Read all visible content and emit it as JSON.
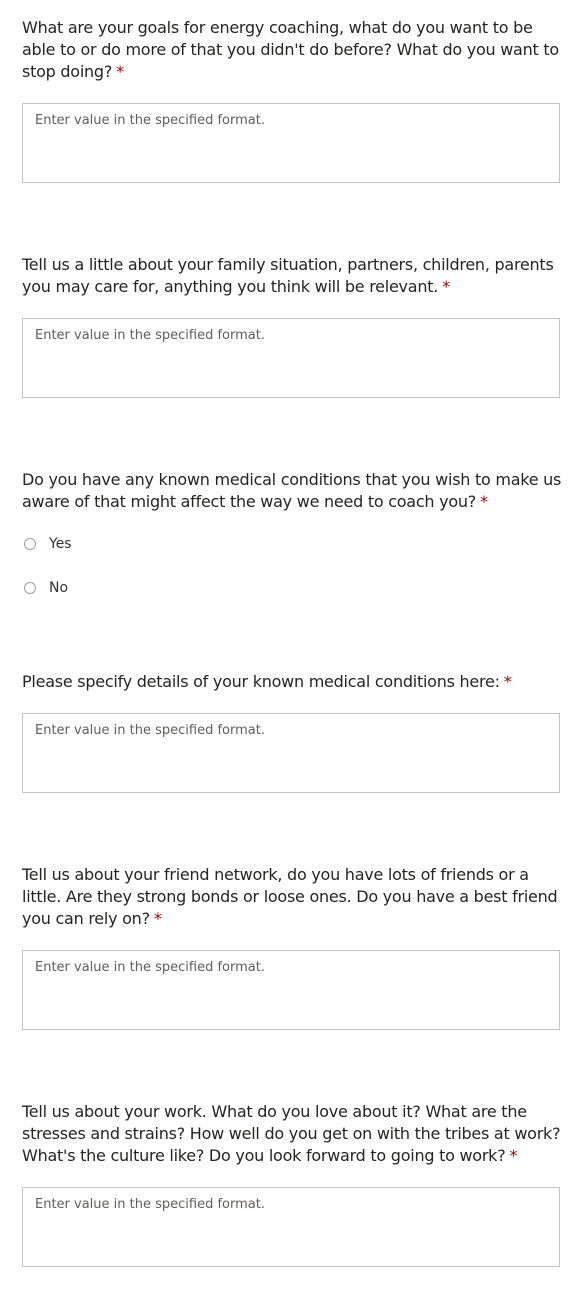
{
  "placeholder": "Enter value in the specified format.",
  "required_marker": "*",
  "questions": [
    {
      "text": "What are your goals for energy coaching, what do you want to be able to or do more of that you didn't do before? What do you want to stop doing?"
    },
    {
      "text": "Tell us a little about your family situation, partners, children, parents you may care for, anything you think will be relevant."
    },
    {
      "text": "Do you have any known medical conditions that you wish to make us aware of that might affect the way we need to coach you?",
      "options": [
        "Yes",
        "No"
      ]
    },
    {
      "text": "Please specify details of your known medical conditions here:"
    },
    {
      "text": "Tell us about your friend network, do you have lots of friends or a little. Are they strong bonds or loose ones. Do you have a best friend you can rely on?"
    },
    {
      "text": "Tell us about your work. What do you love about it? What are the stresses and strains? How well do you get on with the tribes at work? What's the culture like? Do you look forward to going to work?"
    }
  ]
}
